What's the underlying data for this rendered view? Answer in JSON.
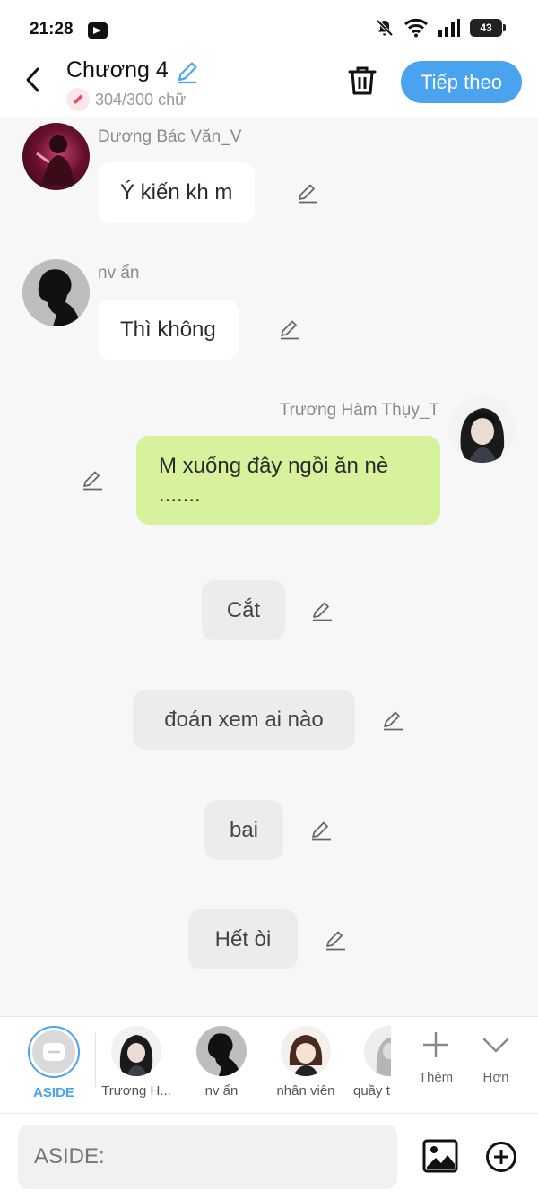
{
  "status": {
    "time": "21:28",
    "battery": "43"
  },
  "header": {
    "title": "Chương 4",
    "word_count": "304/300 chữ",
    "next_label": "Tiếp theo"
  },
  "messages": [
    {
      "sender": "Dương Bác Văn_V",
      "text": "Ý kiến kh m"
    },
    {
      "sender": "nv ẩn",
      "text": "Thì không"
    },
    {
      "sender": "Trương Hàm Thụy_T",
      "text": "M xuống đây ngồi ăn nè ......."
    }
  ],
  "asides": [
    "Cắt",
    "đoán xem ai nào",
    "bai",
    "Hết òi"
  ],
  "characters": {
    "aside": "ASIDE",
    "c1": "Trương H...",
    "c2": "nv ẩn",
    "c3": "nhân viên",
    "c4": "quầy t"
  },
  "tools": {
    "more": "Thêm",
    "hon": "Hơn"
  },
  "input": {
    "placeholder": "ASIDE:"
  },
  "colors": {
    "accent": "#4aa3ee",
    "green_bubble": "#d6f29c",
    "background": "#f7f7f7"
  }
}
